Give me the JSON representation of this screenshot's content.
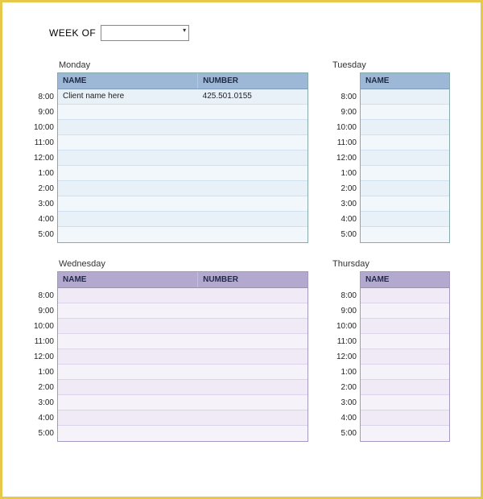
{
  "weekof_label": "WEEK OF",
  "weekof_value": "",
  "time_slots": [
    "8:00",
    "9:00",
    "10:00",
    "11:00",
    "12:00",
    "1:00",
    "2:00",
    "3:00",
    "4:00",
    "5:00"
  ],
  "headers": {
    "name": "NAME",
    "number": "NUMBER"
  },
  "days": {
    "monday": {
      "title": "Monday",
      "rows": [
        {
          "name": "Client name here",
          "number": "425.501.0155"
        },
        {},
        {},
        {},
        {},
        {},
        {},
        {},
        {},
        {}
      ]
    },
    "tuesday": {
      "title": "Tuesday",
      "rows": [
        {},
        {},
        {},
        {},
        {},
        {},
        {},
        {},
        {},
        {}
      ]
    },
    "wednesday": {
      "title": "Wednesday",
      "rows": [
        {},
        {},
        {},
        {},
        {},
        {},
        {},
        {},
        {},
        {}
      ]
    },
    "thursday": {
      "title": "Thursday",
      "rows": [
        {},
        {},
        {},
        {},
        {},
        {},
        {},
        {},
        {},
        {}
      ]
    }
  }
}
